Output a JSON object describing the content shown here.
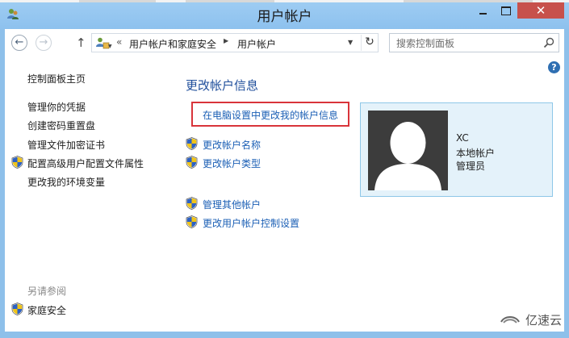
{
  "window": {
    "title": "用户帐户",
    "close_glyph": "✕"
  },
  "navbar": {
    "back_glyph": "←",
    "forward_glyph": "→",
    "up_glyph": "↑",
    "path_overflow": "«",
    "breadcrumbs": [
      "用户帐户和家庭安全",
      "用户帐户"
    ],
    "crumb_separator": "▶",
    "refresh_glyph": "↻",
    "search_placeholder": "搜索控制面板"
  },
  "help_glyph": "?",
  "sidebar": {
    "home": "控制面板主页",
    "items": [
      {
        "label": "管理你的凭据",
        "icon": "none"
      },
      {
        "label": "创建密码重置盘",
        "icon": "none"
      },
      {
        "label": "管理文件加密证书",
        "icon": "none"
      },
      {
        "label": "配置高级用户配置文件属性",
        "icon": "shield-icon"
      },
      {
        "label": "更改我的环境变量",
        "icon": "none"
      }
    ],
    "see_also_title": "另请参阅",
    "see_also_items": [
      {
        "label": "家庭安全",
        "icon": "shield-icon"
      }
    ]
  },
  "main": {
    "heading": "更改帐户信息",
    "pc_settings_link": "在电脑设置中更改我的帐户信息",
    "tasks": [
      {
        "label": "更改帐户名称",
        "icon": "shield-icon"
      },
      {
        "label": "更改帐户类型",
        "icon": "shield-icon"
      },
      {
        "label": "管理其他帐户",
        "icon": "shield-icon"
      },
      {
        "label": "更改用户帐户控制设置",
        "icon": "shield-icon"
      }
    ]
  },
  "account": {
    "name": "XC",
    "type": "本地帐户",
    "role": "管理员"
  },
  "watermark": {
    "text": "亿速云"
  },
  "colors": {
    "titlebar": "#8dc1ee",
    "link": "#1b5fb5",
    "heading": "#1f4e9b",
    "highlight_border": "#d9343a",
    "card_bg": "#e4f2fa",
    "close_button": "#c7514c"
  }
}
